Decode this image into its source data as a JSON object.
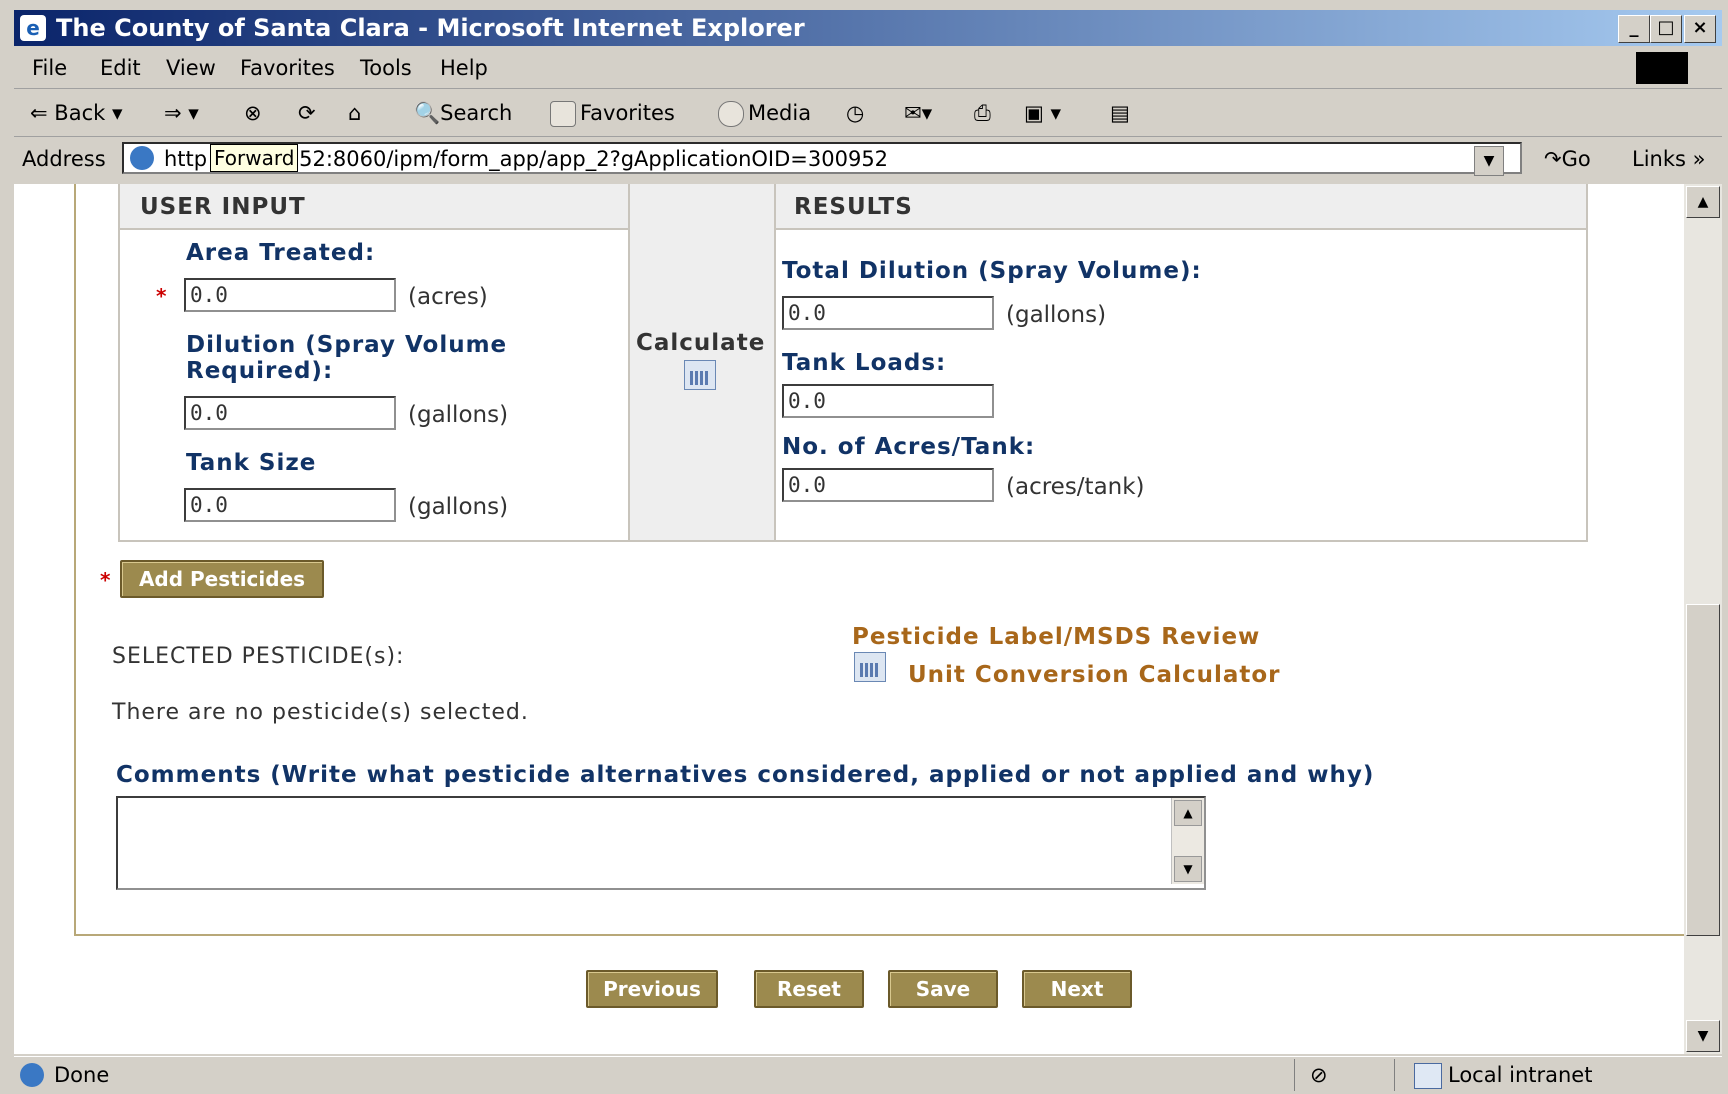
{
  "window": {
    "title": "The County of Santa Clara - Microsoft Internet Explorer"
  },
  "menu": [
    "File",
    "Edit",
    "View",
    "Favorites",
    "Tools",
    "Help"
  ],
  "toolbar": {
    "back": "Back",
    "search": "Search",
    "favorites": "Favorites",
    "media": "Media"
  },
  "address": {
    "label": "Address",
    "url": "http://...52:8060/ipm/form_app/app_2?gApplicationOID=300952",
    "url_visible_prefix": "http",
    "url_visible_suffix": "52:8060/ipm/form_app/app_2?gApplicationOID=300952",
    "tooltip": "Forward",
    "go": "Go",
    "links": "Links"
  },
  "form": {
    "user_input_header": "USER INPUT",
    "results_header": "RESULTS",
    "area_label": "Area Treated:",
    "area_value": "0.0",
    "area_unit": "(acres)",
    "dilution_label_1": "Dilution (Spray Volume",
    "dilution_label_2": "Required):",
    "dilution_value": "0.0",
    "dilution_unit": "(gallons)",
    "tank_size_label": "Tank Size",
    "tank_size_value": "0.0",
    "tank_size_unit": "(gallons)",
    "calculate_label": "Calculate",
    "total_dilution_label": "Total Dilution (Spray Volume):",
    "total_dilution_value": "0.0",
    "total_dilution_unit": "(gallons)",
    "tank_loads_label": "Tank Loads:",
    "tank_loads_value": "0.0",
    "acres_tank_label": "No. of Acres/Tank:",
    "acres_tank_value": "0.0",
    "acres_tank_unit": "(acres/tank)",
    "required_mark": "*",
    "add_pesticides": "Add Pesticides",
    "selected_label": "SELECTED PESTICIDE(s):",
    "no_selection": "There are no pesticide(s) selected.",
    "msds_link": "Pesticide Label/MSDS Review",
    "unit_conv_link": "Unit Conversion Calculator",
    "comments_label": "Comments (Write what pesticide alternatives considered, applied or not applied and why)"
  },
  "nav_buttons": {
    "previous": "Previous",
    "reset": "Reset",
    "save": "Save",
    "next": "Next"
  },
  "status": {
    "text": "Done",
    "zone": "Local intranet"
  }
}
